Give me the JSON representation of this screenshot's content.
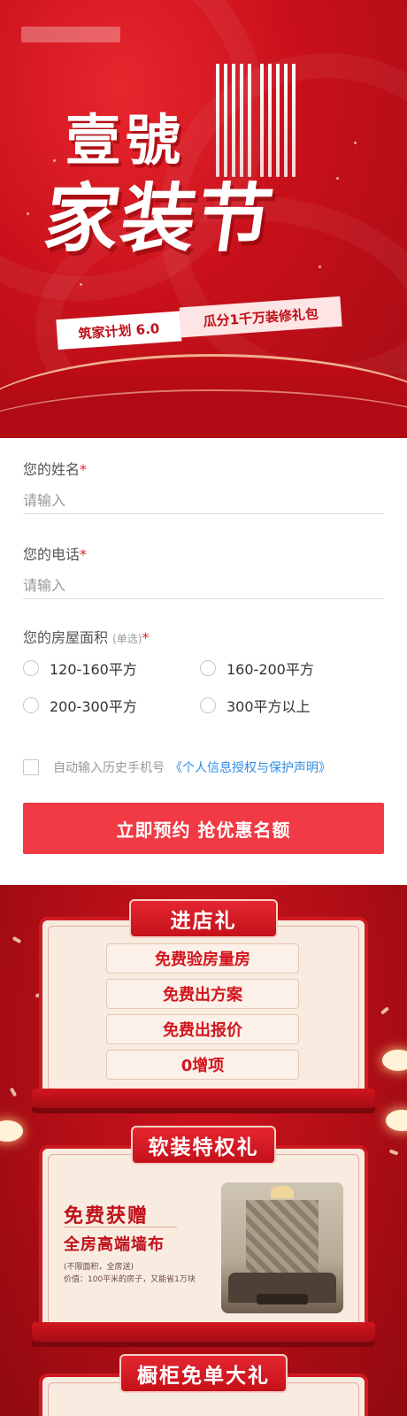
{
  "hero": {
    "title_line1": "壹號",
    "title_line2": "家装节",
    "subtitle_left": "筑家计划 6.0",
    "subtitle_right": "瓜分1千万装修礼包"
  },
  "form": {
    "name_label": "您的姓名",
    "name_placeholder": "请输入",
    "phone_label": "您的电话",
    "phone_placeholder": "请输入",
    "area_label": "您的房屋面积",
    "area_note": "(单选)",
    "required_mark": "*",
    "area_options": [
      "120-160平方",
      "160-200平方",
      "200-300平方",
      "300平方以上"
    ],
    "agree_text": "自动输入历史手机号",
    "agree_link": "《个人信息授权与保护声明》",
    "submit_label": "立即预约 抢优惠名额"
  },
  "gifts": {
    "store_gift": {
      "title": "进店礼",
      "items": [
        "免费验房量房",
        "免费出方案",
        "免费出报价",
        "0增项"
      ]
    },
    "soft_gift": {
      "title": "软装特权礼",
      "lead": "免费获赠",
      "headline": "全房高端墙布",
      "note1": "(不限面积，全房送)",
      "note2": "价值：100平米的房子，又能省1万块"
    },
    "cabinet_gift": {
      "title": "橱柜免单大礼"
    }
  },
  "colors": {
    "brand_red": "#d2161f",
    "button_red": "#f13a45",
    "link_blue": "#2f8de4",
    "panel_cream": "#f8ece0"
  }
}
